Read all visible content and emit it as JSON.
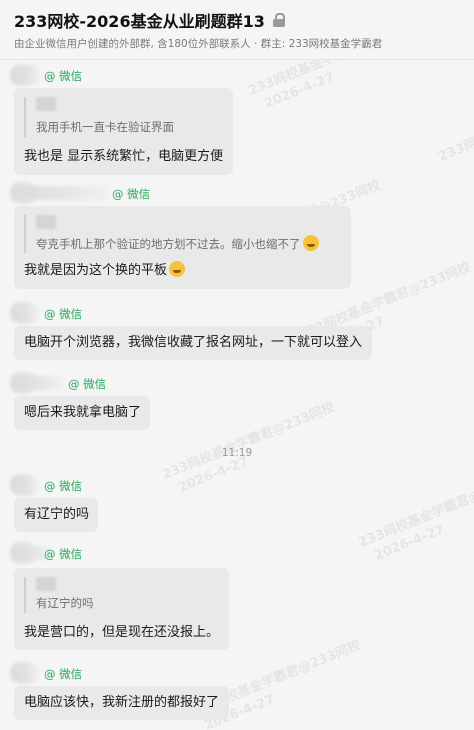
{
  "header": {
    "title": "233网校-2026基金从业刷题群13",
    "subtitle": "由企业微信用户创建的外部群, 含180位外部联系人 · 群主: 233网校基金学霸君"
  },
  "wechat_tag": "@ 微信",
  "watermark": {
    "line1": "233网校基金学霸君@233网校",
    "line2": "2026-4-27",
    "line3": "233网校"
  },
  "messages": [
    {
      "text": "我也是 显示系统繁忙，电脑更方便",
      "quote": "我用手机一直卡在验证界面"
    },
    {
      "text": "我就是因为这个换的平板",
      "quote": "夸克手机上那个验证的地方划不过去。缩小也缩不了"
    },
    {
      "text": "电脑开个浏览器，我微信收藏了报名网址，一下就可以登入"
    },
    {
      "text": "嗯后来我就拿电脑了"
    },
    {
      "text": "有辽宁的吗"
    },
    {
      "text": "我是营口的，但是现在还没报上。",
      "quote": "有辽宁的吗"
    },
    {
      "text": "电脑应该快，我新注册的都报好了"
    }
  ],
  "timestamp": "11:19",
  "colors": {
    "wechat_green": "#23a65a",
    "bubble": "#e9e9e9",
    "background": "#f5f5f5"
  }
}
